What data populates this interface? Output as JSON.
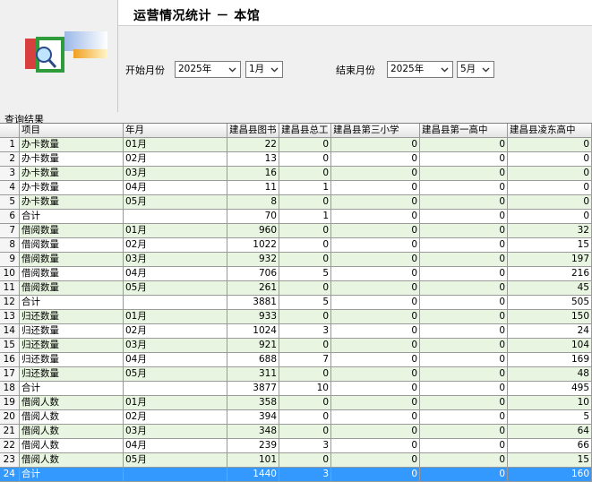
{
  "header": {
    "title": "运营情况统计 － 本馆",
    "start_label": "开始月份",
    "start_year": "2025年",
    "start_month": "1月",
    "end_label": "结束月份",
    "end_year": "2025年",
    "end_month": "5月"
  },
  "result_label": "查询结果",
  "table": {
    "columns": [
      "项目",
      "年月",
      "建昌县图书",
      "建昌县总工",
      "建昌县第三小学",
      "建昌县第一高中",
      "建昌县凌东高中"
    ],
    "rows": [
      [
        "1",
        "办卡数量",
        "01月",
        "22",
        "0",
        "0",
        "0",
        "0"
      ],
      [
        "2",
        "办卡数量",
        "02月",
        "13",
        "0",
        "0",
        "0",
        "0"
      ],
      [
        "3",
        "办卡数量",
        "03月",
        "16",
        "0",
        "0",
        "0",
        "0"
      ],
      [
        "4",
        "办卡数量",
        "04月",
        "11",
        "1",
        "0",
        "0",
        "0"
      ],
      [
        "5",
        "办卡数量",
        "05月",
        "8",
        "0",
        "0",
        "0",
        "0"
      ],
      [
        "6",
        "合计",
        "",
        "70",
        "1",
        "0",
        "0",
        "0"
      ],
      [
        "7",
        "借阅数量",
        "01月",
        "960",
        "0",
        "0",
        "0",
        "32"
      ],
      [
        "8",
        "借阅数量",
        "02月",
        "1022",
        "0",
        "0",
        "0",
        "15"
      ],
      [
        "9",
        "借阅数量",
        "03月",
        "932",
        "0",
        "0",
        "0",
        "197"
      ],
      [
        "10",
        "借阅数量",
        "04月",
        "706",
        "5",
        "0",
        "0",
        "216"
      ],
      [
        "11",
        "借阅数量",
        "05月",
        "261",
        "0",
        "0",
        "0",
        "45"
      ],
      [
        "12",
        "合计",
        "",
        "3881",
        "5",
        "0",
        "0",
        "505"
      ],
      [
        "13",
        "归还数量",
        "01月",
        "933",
        "0",
        "0",
        "0",
        "150"
      ],
      [
        "14",
        "归还数量",
        "02月",
        "1024",
        "3",
        "0",
        "0",
        "24"
      ],
      [
        "15",
        "归还数量",
        "03月",
        "921",
        "0",
        "0",
        "0",
        "104"
      ],
      [
        "16",
        "归还数量",
        "04月",
        "688",
        "7",
        "0",
        "0",
        "169"
      ],
      [
        "17",
        "归还数量",
        "05月",
        "311",
        "0",
        "0",
        "0",
        "48"
      ],
      [
        "18",
        "合计",
        "",
        "3877",
        "10",
        "0",
        "0",
        "495"
      ],
      [
        "19",
        "借阅人数",
        "01月",
        "358",
        "0",
        "0",
        "0",
        "10"
      ],
      [
        "20",
        "借阅人数",
        "02月",
        "394",
        "0",
        "0",
        "0",
        "5"
      ],
      [
        "21",
        "借阅人数",
        "03月",
        "348",
        "0",
        "0",
        "0",
        "64"
      ],
      [
        "22",
        "借阅人数",
        "04月",
        "239",
        "3",
        "0",
        "0",
        "66"
      ],
      [
        "23",
        "借阅人数",
        "05月",
        "101",
        "0",
        "0",
        "0",
        "15"
      ],
      [
        "24",
        "合计",
        "",
        "1440",
        "3",
        "0",
        "0",
        "160"
      ]
    ],
    "selected_row": "24"
  },
  "icons": {
    "logo": "report-search-icon",
    "dropdown": "chevron-down-icon"
  },
  "colors": {
    "alt_row": "#e8f5e1",
    "selection": "#3399ff"
  }
}
